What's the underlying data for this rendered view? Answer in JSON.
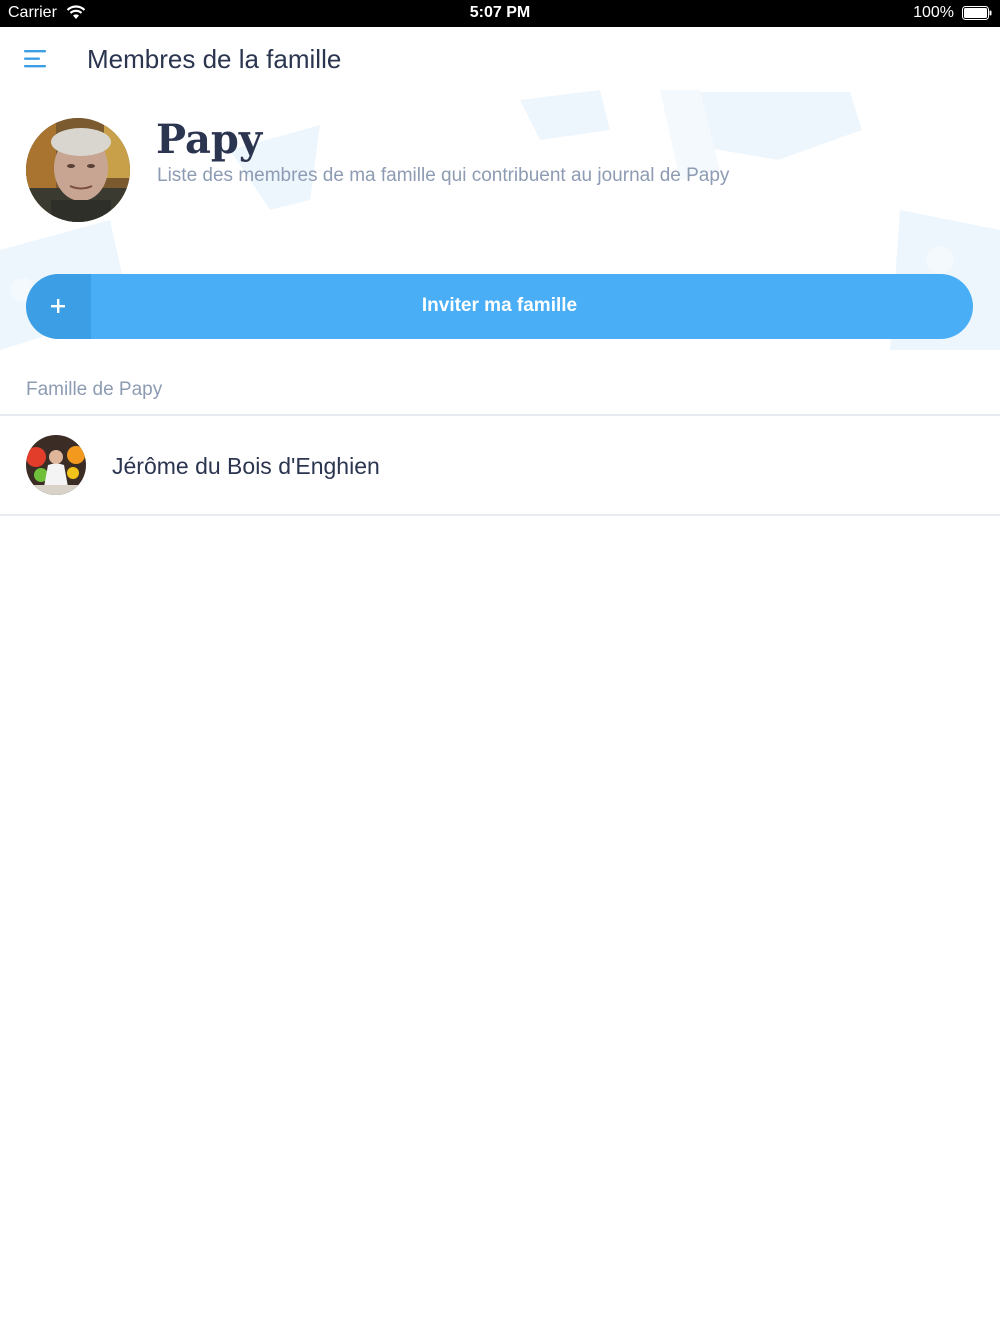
{
  "status_bar": {
    "carrier": "Carrier",
    "time": "5:07 PM",
    "battery": "100%"
  },
  "header": {
    "title": "Membres de la famille"
  },
  "profile": {
    "name": "Papy",
    "description": "Liste des membres de ma famille qui contribuent au journal de Papy"
  },
  "invite_button": {
    "label": "Inviter ma famille",
    "icon": "plus-icon"
  },
  "family_section": {
    "title": "Famille de Papy",
    "members": [
      {
        "name": "Jérôme du Bois d'Enghien"
      }
    ]
  },
  "colors": {
    "accent": "#49aef5",
    "title_text": "#2b3550",
    "muted_text": "#8d9bb3",
    "divider": "#e8ebef"
  }
}
